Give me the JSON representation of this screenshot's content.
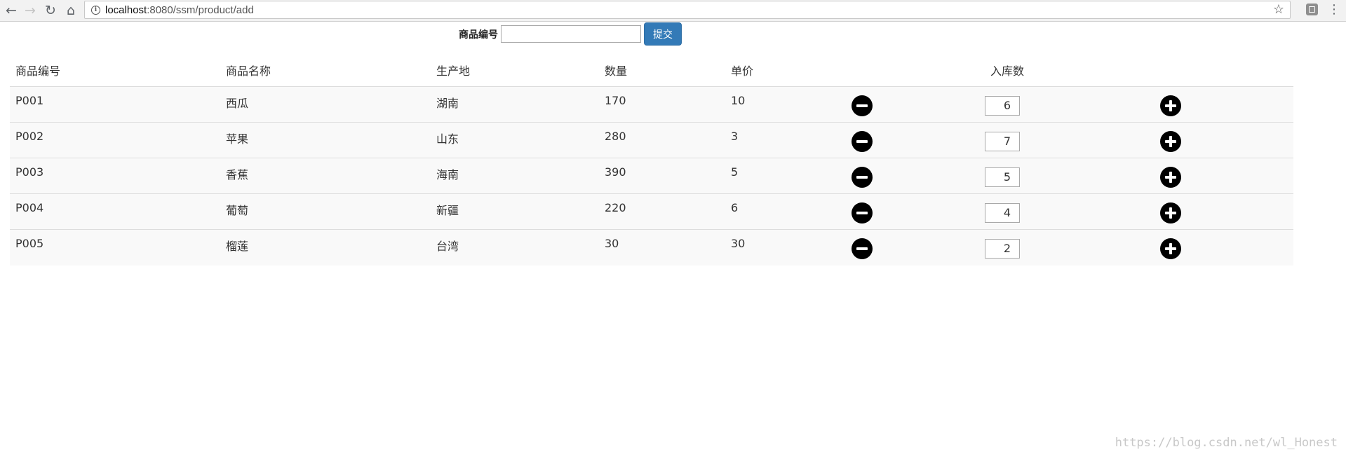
{
  "browser": {
    "url_host": "localhost",
    "url_rest": ":8080/ssm/product/add"
  },
  "form": {
    "label": "商品编号",
    "input_value": "",
    "submit_label": "提交"
  },
  "table": {
    "headers": [
      "商品编号",
      "商品名称",
      "生产地",
      "数量",
      "单价",
      "",
      "入库数",
      ""
    ],
    "rows": [
      {
        "id": "P001",
        "name": "西瓜",
        "origin": "湖南",
        "quantity": "170",
        "price": "10",
        "inbound": "6"
      },
      {
        "id": "P002",
        "name": "苹果",
        "origin": "山东",
        "quantity": "280",
        "price": "3",
        "inbound": "7"
      },
      {
        "id": "P003",
        "name": "香蕉",
        "origin": "海南",
        "quantity": "390",
        "price": "5",
        "inbound": "5"
      },
      {
        "id": "P004",
        "name": "葡萄",
        "origin": "新疆",
        "quantity": "220",
        "price": "6",
        "inbound": "4"
      },
      {
        "id": "P005",
        "name": "榴莲",
        "origin": "台湾",
        "quantity": "30",
        "price": "30",
        "inbound": "2"
      }
    ]
  },
  "watermark": "https://blog.csdn.net/wl_Honest",
  "icons": {
    "back": "arrow-left-icon",
    "forward": "arrow-right-icon",
    "reload": "reload-icon",
    "home": "home-icon",
    "info": "info-icon",
    "star": "star-icon",
    "decrease": "minus-circle-icon",
    "increase": "plus-circle-icon"
  },
  "colors": {
    "primary": "#337ab7",
    "row_stripe": "#f9f9f9",
    "border": "#dddddd"
  }
}
